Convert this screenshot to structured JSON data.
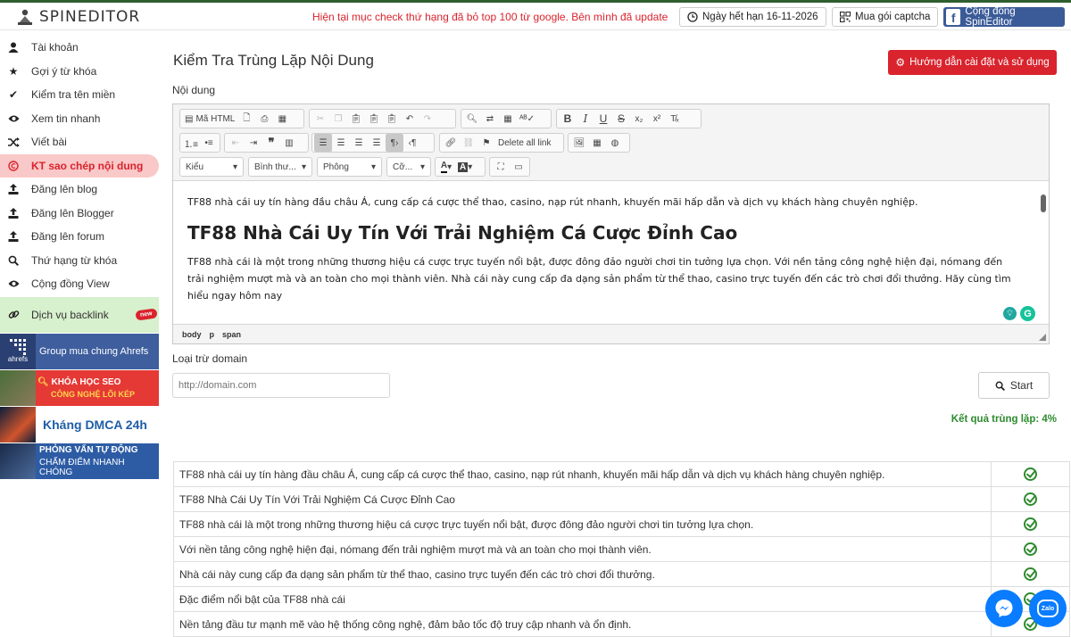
{
  "header": {
    "logo_text": "SPINEDITOR",
    "marquee": "Hiện tại mục check thứ hạng đã bỏ top 100 từ google. Bên mình đã update l",
    "expiry_label": "Ngày hết hạn 16-11-2026",
    "captcha_label": "Mua gói captcha",
    "community_label": "Cộng đồng SpinEditor"
  },
  "sidebar": {
    "items": [
      {
        "label": "Tài khoản",
        "icon": "user-icon"
      },
      {
        "label": "Gợi ý từ khóa",
        "icon": "star-icon"
      },
      {
        "label": "Kiểm tra tên miền",
        "icon": "check-icon"
      },
      {
        "label": "Xem tin nhanh",
        "icon": "eye-icon"
      },
      {
        "label": "Viết bài",
        "icon": "shuffle-icon"
      },
      {
        "label": "KT sao chép nội dung",
        "icon": "copyright-icon",
        "active": true
      },
      {
        "label": "Đăng lên blog",
        "icon": "upload-icon"
      },
      {
        "label": "Đăng lên Blogger",
        "icon": "upload-icon"
      },
      {
        "label": "Đăng lên forum",
        "icon": "upload-icon"
      },
      {
        "label": "Thứ hạng từ khóa",
        "icon": "search-icon"
      },
      {
        "label": "Cộng đồng View",
        "icon": "eye-icon"
      }
    ],
    "backlink_label": "Dịch vụ backlink",
    "new_badge": "new",
    "banners": {
      "ahrefs_logo": "ahrefs",
      "ahrefs_text": "Group mua chung Ahrefs",
      "seo_line1": "KHÓA HỌC SEO",
      "seo_line2": "CÔNG NGHỆ LÕI KÉP",
      "dmca_text": "Kháng DMCA 24h",
      "interview_line1": "PHỎNG VẤN TỰ ĐỘNG",
      "interview_line2": "CHẤM ĐIỂM NHANH CHÓNG"
    }
  },
  "main": {
    "title": "Kiểm Tra Trùng Lặp Nội Dung",
    "guide_button": "Hướng dẫn cài đặt và sử dụng",
    "content_label": "Nội dung",
    "toolbar": {
      "source_label": "Mã HTML",
      "delete_links_label": "Delete all link",
      "style_combo": "Kiểu",
      "format_combo": "Bình thư...",
      "font_combo": "Phông",
      "size_combo": "Cỡ..."
    },
    "document": {
      "para1": "TF88 nhà cái uy tín hàng đầu châu Á, cung cấp cá cược thể thao, casino, nạp rút nhanh, khuyến mãi hấp dẫn và dịch vụ khách hàng chuyên nghiệp.",
      "heading": "TF88 Nhà Cái Uy Tín Với Trải Nghiệm Cá Cược Đỉnh Cao",
      "para2": "TF88 nhà cái là một trong những thương hiệu cá cược trực tuyến nổi bật, được đông đảo người chơi tin tưởng lựa chọn. Với nền tảng công nghệ hiện đại, nómang đến trải nghiệm mượt mà và an toàn cho mọi thành viên. Nhà cái này cung cấp đa dạng sản phẩm từ thể thao, casino trực tuyến đến các trò chơi đổi thưởng. Hãy cùng tìm hiểu ngay hôm nay"
    },
    "path": [
      "body",
      "p",
      "span"
    ],
    "exclude_label": "Loại trừ domain",
    "domain_placeholder": "http://domain.com",
    "start_label": "Start",
    "result_text": "Kết quả trùng lặp: 4%",
    "rows": [
      "TF88 nhà cái uy tín hàng đầu châu Á, cung cấp cá cược thể thao, casino, nạp rút nhanh, khuyến mãi hấp dẫn và dịch vụ khách hàng chuyên nghiệp.",
      "TF88 Nhà Cái Uy Tín Với Trải Nghiệm Cá Cược Đỉnh Cao",
      "TF88 nhà cái là một trong những thương hiệu cá cược trực tuyến nổi bật, được đông đảo người chơi tin tưởng lựa chọn.",
      "Với nền tảng công nghệ hiện đại, nómang đến trải nghiệm mượt mà và an toàn cho mọi thành viên.",
      "Nhà cái này cung cấp đa dạng sản phẩm từ thể thao, casino trực tuyến đến các trò chơi đổi thưởng.",
      "Đặc điểm nổi bật của TF88 nhà cái",
      "Nền tảng đầu tư mạnh mẽ vào hệ thống công nghệ, đảm bảo tốc độ truy cập nhanh và ổn định."
    ]
  },
  "floating": {
    "zalo_label": "Zalo"
  },
  "colors": {
    "accent_red": "#d9232d",
    "success_green": "#2e8b2e",
    "facebook_blue": "#3b5b98",
    "messenger_blue": "#0a7cff"
  }
}
